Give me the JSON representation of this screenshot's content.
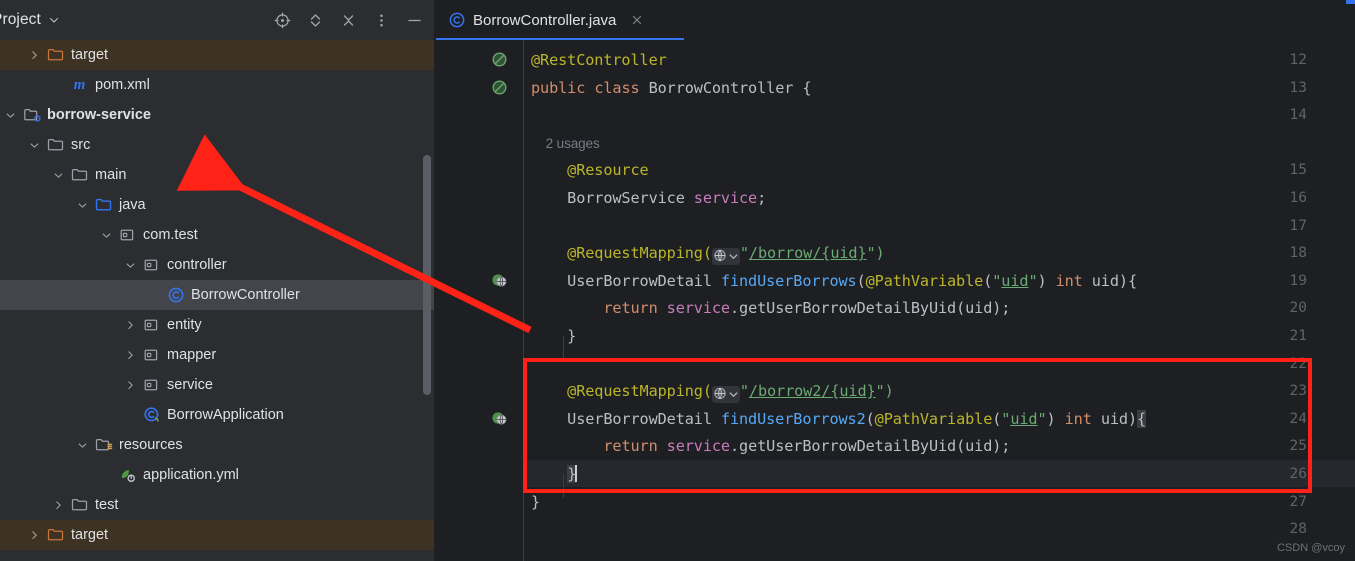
{
  "project_panel": {
    "title": "Project",
    "title_chevron_icon": "chevron-down-icon",
    "toolbar_icons": [
      {
        "name": "select-opened-file-icon",
        "tooltip": "Select Opened File"
      },
      {
        "name": "expand-collapse-icon",
        "tooltip": "Expand / Collapse"
      },
      {
        "name": "collapse-all-icon",
        "tooltip": "Collapse All"
      },
      {
        "name": "more-options-icon",
        "tooltip": "Options"
      },
      {
        "name": "hide-icon",
        "tooltip": "Hide"
      }
    ],
    "tree": [
      {
        "label": "target",
        "indent": 2,
        "arrow": "collapsed",
        "icon": "folder-excluded-icon",
        "state": "excluded",
        "bold": false
      },
      {
        "label": "pom.xml",
        "indent": 3,
        "arrow": "none",
        "icon": "maven-file-icon",
        "state": "normal",
        "bold": false
      },
      {
        "label": "borrow-service",
        "indent": 1,
        "arrow": "expanded",
        "icon": "module-icon",
        "state": "normal",
        "bold": true
      },
      {
        "label": "src",
        "indent": 2,
        "arrow": "expanded",
        "icon": "folder-icon",
        "state": "normal",
        "bold": false
      },
      {
        "label": "main",
        "indent": 3,
        "arrow": "expanded",
        "icon": "folder-icon",
        "state": "normal",
        "bold": false
      },
      {
        "label": "java",
        "indent": 4,
        "arrow": "expanded",
        "icon": "source-root-icon",
        "state": "normal",
        "bold": false
      },
      {
        "label": "com.test",
        "indent": 5,
        "arrow": "expanded",
        "icon": "package-icon",
        "state": "normal",
        "bold": false
      },
      {
        "label": "controller",
        "indent": 6,
        "arrow": "expanded",
        "icon": "package-icon",
        "state": "normal",
        "bold": false
      },
      {
        "label": "BorrowController",
        "indent": 7,
        "arrow": "none",
        "icon": "java-class-icon",
        "state": "selected",
        "bold": false
      },
      {
        "label": "entity",
        "indent": 6,
        "arrow": "collapsed",
        "icon": "package-icon",
        "state": "normal",
        "bold": false
      },
      {
        "label": "mapper",
        "indent": 6,
        "arrow": "collapsed",
        "icon": "package-icon",
        "state": "normal",
        "bold": false
      },
      {
        "label": "service",
        "indent": 6,
        "arrow": "collapsed",
        "icon": "package-icon",
        "state": "normal",
        "bold": false
      },
      {
        "label": "BorrowApplication",
        "indent": 6,
        "arrow": "none",
        "icon": "spring-class-icon",
        "state": "normal",
        "bold": false
      },
      {
        "label": "resources",
        "indent": 4,
        "arrow": "expanded",
        "icon": "resource-root-icon",
        "state": "normal",
        "bold": false
      },
      {
        "label": "application.yml",
        "indent": 5,
        "arrow": "none",
        "icon": "spring-yaml-icon",
        "state": "normal",
        "bold": false
      },
      {
        "label": "test",
        "indent": 3,
        "arrow": "collapsed",
        "icon": "folder-icon",
        "state": "normal",
        "bold": false
      },
      {
        "label": "target",
        "indent": 2,
        "arrow": "collapsed",
        "icon": "folder-excluded-icon",
        "state": "excluded",
        "bold": false
      }
    ]
  },
  "editor": {
    "tab": {
      "label": "BorrowController.java",
      "file_icon": "java-class-icon",
      "close_icon": "close-icon",
      "active": true,
      "accent_color": "#3574F0"
    },
    "lines": [
      {
        "num": "12",
        "gutter": "inspection-suppress-icon",
        "tokens": [
          {
            "t": "@RestController",
            "c": "c-anno"
          }
        ]
      },
      {
        "num": "13",
        "gutter": "inspection-suppress-icon",
        "tokens": [
          {
            "t": "public ",
            "c": "c-kw"
          },
          {
            "t": "class ",
            "c": "c-kw"
          },
          {
            "t": "BorrowController ",
            "c": "c-plain"
          },
          {
            "t": "{",
            "c": "c-plain"
          }
        ]
      },
      {
        "num": "14",
        "gutter": "",
        "tokens": []
      },
      {
        "num": "",
        "gutter": "",
        "inlay": "2 usages"
      },
      {
        "num": "15",
        "gutter": "",
        "tokens": [
          {
            "t": "    @Resource",
            "c": "c-anno"
          }
        ]
      },
      {
        "num": "16",
        "gutter": "",
        "tokens": [
          {
            "t": "    BorrowService ",
            "c": "c-plain"
          },
          {
            "t": "service",
            "c": "c-field"
          },
          {
            "t": ";",
            "c": "c-plain"
          }
        ]
      },
      {
        "num": "17",
        "gutter": "",
        "tokens": []
      },
      {
        "num": "18",
        "gutter": "",
        "tokens": [
          {
            "t": "    @RequestMapping(",
            "c": "c-anno"
          }
        ],
        "badge": "web-globe-icon",
        "after": [
          {
            "t": "\"",
            "c": "c-str"
          },
          {
            "t": "/borrow/{uid}",
            "c": "str-link"
          },
          {
            "t": "\")",
            "c": "c-str"
          }
        ]
      },
      {
        "num": "19",
        "gutter": "spring-request-mapping-icon",
        "tokens": [
          {
            "t": "    UserBorrowDetail ",
            "c": "c-plain"
          },
          {
            "t": "findUserBorrows",
            "c": "c-method"
          },
          {
            "t": "(",
            "c": "c-plain"
          },
          {
            "t": "@PathVariable",
            "c": "c-anno"
          },
          {
            "t": "(",
            "c": "c-plain"
          },
          {
            "t": "\"",
            "c": "c-str"
          },
          {
            "t": "uid",
            "c": "param-hint"
          },
          {
            "t": "\"",
            "c": "c-str"
          },
          {
            "t": ") ",
            "c": "c-plain"
          },
          {
            "t": "int ",
            "c": "c-kw"
          },
          {
            "t": "uid){",
            "c": "c-plain"
          }
        ]
      },
      {
        "num": "20",
        "gutter": "",
        "tokens": [
          {
            "t": "        ",
            "c": "c-plain"
          },
          {
            "t": "return ",
            "c": "c-kw"
          },
          {
            "t": "service",
            "c": "c-field"
          },
          {
            "t": ".getUserBorrowDetailByUid(uid);",
            "c": "c-plain"
          }
        ]
      },
      {
        "num": "21",
        "gutter": "",
        "tokens": [
          {
            "t": "    }",
            "c": "c-plain"
          }
        ]
      },
      {
        "num": "22",
        "gutter": "",
        "tokens": []
      },
      {
        "num": "23",
        "gutter": "",
        "tokens": [
          {
            "t": "    @RequestMapping(",
            "c": "c-anno"
          }
        ],
        "badge": "web-globe-icon",
        "after": [
          {
            "t": "\"",
            "c": "c-str"
          },
          {
            "t": "/borrow2/{uid}",
            "c": "str-link"
          },
          {
            "t": "\")",
            "c": "c-str"
          }
        ]
      },
      {
        "num": "24",
        "gutter": "spring-request-mapping-icon",
        "tokens": [
          {
            "t": "    UserBorrowDetail ",
            "c": "c-plain"
          },
          {
            "t": "findUserBorrows2",
            "c": "c-method"
          },
          {
            "t": "(",
            "c": "c-plain"
          },
          {
            "t": "@PathVariable",
            "c": "c-anno"
          },
          {
            "t": "(",
            "c": "c-plain"
          },
          {
            "t": "\"",
            "c": "c-str"
          },
          {
            "t": "uid",
            "c": "param-hint"
          },
          {
            "t": "\"",
            "c": "c-str"
          },
          {
            "t": ") ",
            "c": "c-plain"
          },
          {
            "t": "int ",
            "c": "c-kw"
          },
          {
            "t": "uid)",
            "c": "c-plain"
          }
        ]
      },
      {
        "num": "25",
        "gutter": "",
        "tokens": [
          {
            "t": "        ",
            "c": "c-plain"
          },
          {
            "t": "return ",
            "c": "c-kw"
          },
          {
            "t": "service",
            "c": "c-field"
          },
          {
            "t": ".getUserBorrowDetailByUid(uid);",
            "c": "c-plain"
          }
        ]
      },
      {
        "num": "26",
        "gutter": "",
        "tokens": [
          {
            "t": "    ",
            "c": "c-plain"
          }
        ],
        "highlight": true
      },
      {
        "num": "27",
        "gutter": "",
        "tokens": [
          {
            "t": "}",
            "c": "c-plain"
          }
        ]
      },
      {
        "num": "28",
        "gutter": "",
        "tokens": []
      }
    ],
    "inlay_hint": "2 usages",
    "caret_line": "26",
    "brace_match_open": "{",
    "brace_match_close": "}"
  },
  "annotations": {
    "highlight_box_color": "#FF2217",
    "arrow_color": "#FF2217",
    "arrow_description": "red-arrow-pointing-to-project-tree"
  },
  "watermark": {
    "text": "CSDN @vcoy"
  }
}
